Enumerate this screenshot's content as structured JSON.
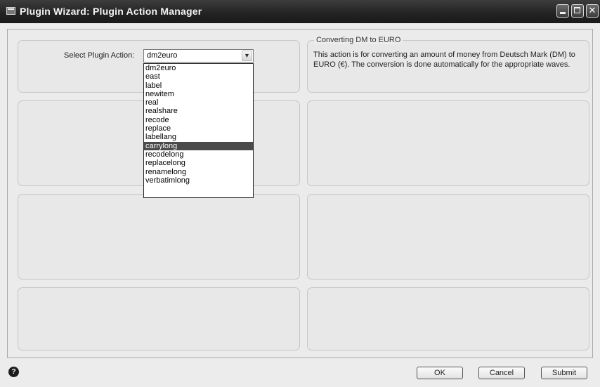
{
  "window": {
    "title": "Plugin Wizard: Plugin Action Manager",
    "close_glyph": "✕"
  },
  "action_selector": {
    "label": "Select Plugin Action:",
    "value": "dm2euro",
    "options": [
      {
        "label": "dm2euro",
        "selected": false
      },
      {
        "label": "east",
        "selected": false
      },
      {
        "label": "label",
        "selected": false
      },
      {
        "label": "newitem",
        "selected": false
      },
      {
        "label": "real",
        "selected": false
      },
      {
        "label": "realshare",
        "selected": false
      },
      {
        "label": "recode",
        "selected": false
      },
      {
        "label": "replace",
        "selected": false
      },
      {
        "label": "labellang",
        "selected": false
      },
      {
        "label": "carrylong",
        "selected": true
      },
      {
        "label": "recodelong",
        "selected": false
      },
      {
        "label": "replacelong",
        "selected": false
      },
      {
        "label": "renamelong",
        "selected": false
      },
      {
        "label": "verbatimlong",
        "selected": false
      }
    ]
  },
  "description": {
    "title": "Converting DM to EURO",
    "text": "This action is for converting an amount of money from Deutsch Mark (DM) to EURO (€). The conversion is done automatically for the appropriate waves."
  },
  "footer": {
    "help_glyph": "?",
    "ok_label": "OK",
    "cancel_label": "Cancel",
    "submit_label": "Submit"
  },
  "icons": {
    "app": "window-icon",
    "dropdown": "chevron-down-icon",
    "help": "help-icon"
  }
}
